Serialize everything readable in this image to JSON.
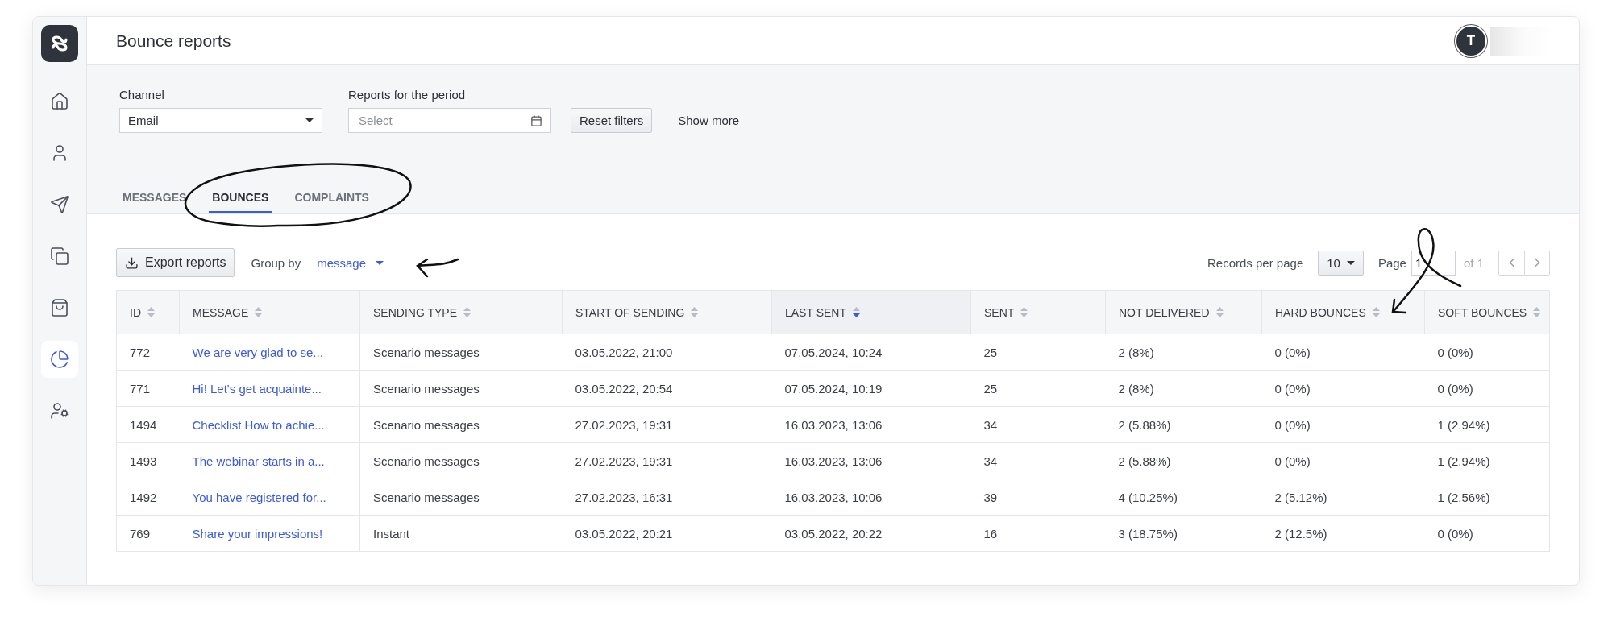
{
  "sidebar": {
    "items": [
      {
        "selected": false
      },
      {
        "selected": false
      },
      {
        "selected": false
      },
      {
        "selected": false
      },
      {
        "selected": false
      },
      {
        "selected": true
      },
      {
        "selected": false
      }
    ]
  },
  "header": {
    "title": "Bounce reports",
    "avatar": "T"
  },
  "filters": {
    "channel": {
      "label": "Channel",
      "value": "Email"
    },
    "period": {
      "label": "Reports for the period",
      "placeholder": "Select"
    },
    "reset": "Reset filters",
    "show_more": "Show more"
  },
  "tabs": [
    {
      "label": "MESSAGES",
      "selected": false
    },
    {
      "label": "BOUNCES",
      "selected": true
    },
    {
      "label": "COMPLAINTS",
      "selected": false
    }
  ],
  "toolbar": {
    "export": "Export reports",
    "group_by_label": "Group by",
    "group_by_value": "message",
    "records_label": "Records per page",
    "records_value": "10",
    "page_label": "Page",
    "page_value": "1",
    "page_total": "of 1"
  },
  "table": {
    "columns": [
      {
        "label": "ID",
        "sorted": false
      },
      {
        "label": "MESSAGE",
        "sorted": false
      },
      {
        "label": "SENDING TYPE",
        "sorted": false
      },
      {
        "label": "START OF SENDING",
        "sorted": false
      },
      {
        "label": "LAST SENT",
        "sorted": true
      },
      {
        "label": "SENT",
        "sorted": false
      },
      {
        "label": "NOT DELIVERED",
        "sorted": false
      },
      {
        "label": "HARD BOUNCES",
        "sorted": false
      },
      {
        "label": "SOFT BOUNCES",
        "sorted": false
      }
    ],
    "rows": [
      [
        "772",
        "We are very glad to se...",
        "Scenario messages",
        "03.05.2022, 21:00",
        "07.05.2024, 10:24",
        "25",
        "2 (8%)",
        "0 (0%)",
        "0 (0%)"
      ],
      [
        "771",
        "Hi! Let's get acquainte...",
        "Scenario messages",
        "03.05.2022, 20:54",
        "07.05.2024, 10:19",
        "25",
        "2 (8%)",
        "0 (0%)",
        "0 (0%)"
      ],
      [
        "1494",
        "Checklist How to achie...",
        "Scenario messages",
        "27.02.2023, 19:31",
        "16.03.2023, 13:06",
        "34",
        "2 (5.88%)",
        "0 (0%)",
        "1 (2.94%)"
      ],
      [
        "1493",
        "The webinar starts in a...",
        "Scenario messages",
        "27.02.2023, 19:31",
        "16.03.2023, 13:06",
        "34",
        "2 (5.88%)",
        "0 (0%)",
        "1 (2.94%)"
      ],
      [
        "1492",
        "You have registered for...",
        "Scenario messages",
        "27.02.2023, 16:31",
        "16.03.2023, 10:06",
        "39",
        "4 (10.25%)",
        "2 (5.12%)",
        "1 (2.56%)"
      ],
      [
        "769",
        "Share your impressions!",
        "Instant",
        "03.05.2022, 20:21",
        "03.05.2022, 20:22",
        "16",
        "3 (18.75%)",
        "2 (12.5%)",
        "0 (0%)"
      ]
    ]
  }
}
